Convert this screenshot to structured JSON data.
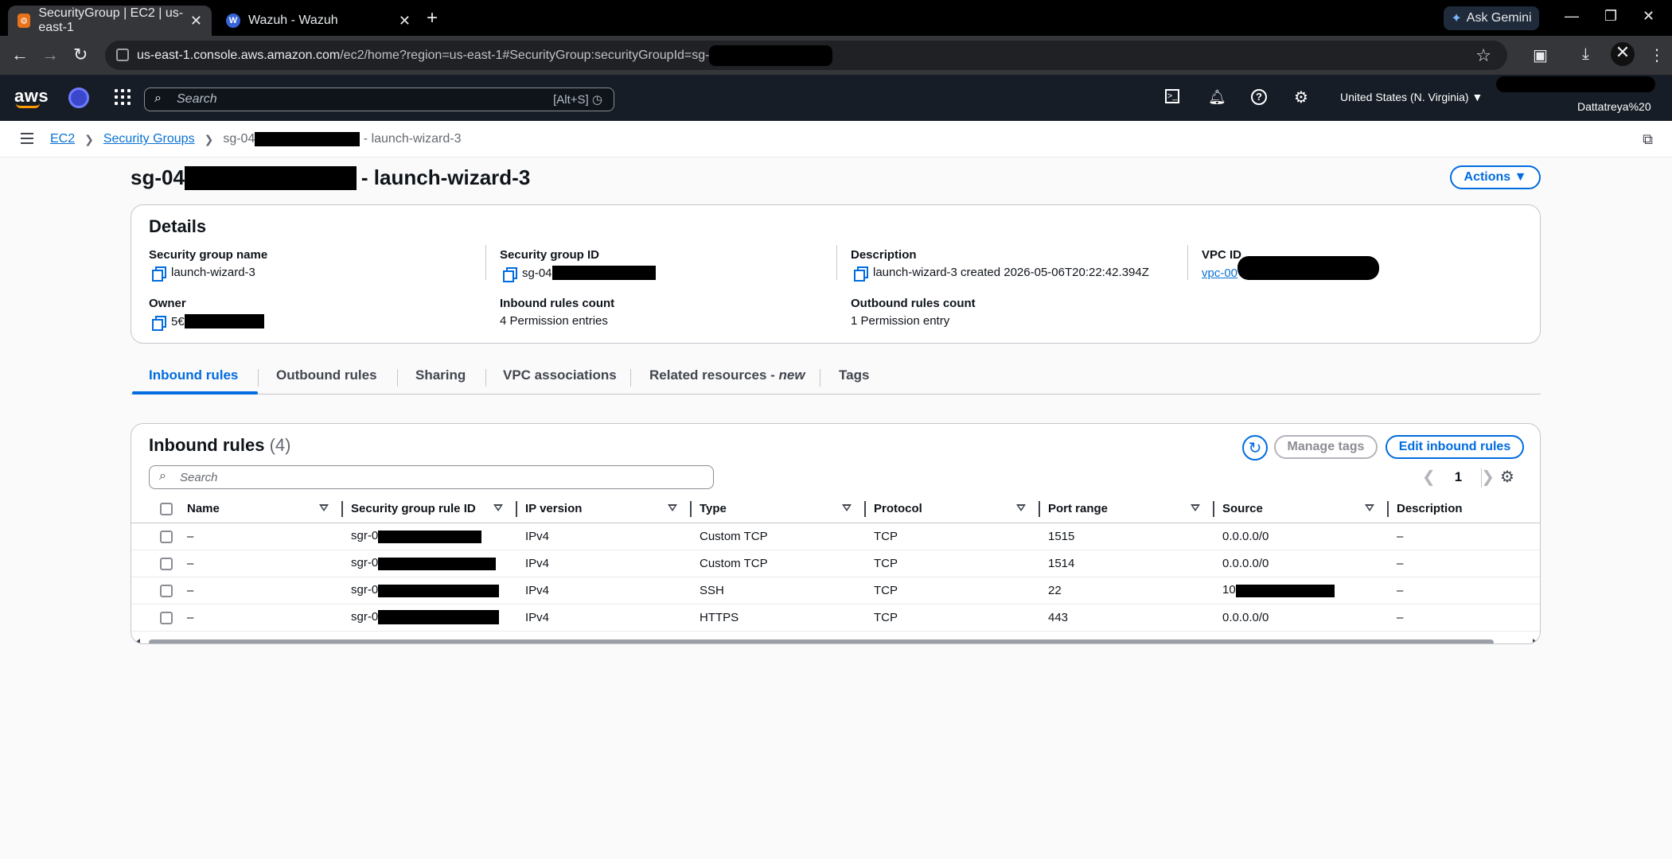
{
  "browser": {
    "tabs": [
      {
        "title": "SecurityGroup | EC2 | us-east-1",
        "active": true
      },
      {
        "title": "Wazuh - Wazuh",
        "active": false
      }
    ],
    "ask_gemini": "Ask Gemini",
    "url_host": "us-east-1.console.aws.amazon.com",
    "url_path": "/ec2/home?region=us-east-1#SecurityGroup:securityGroupId=sg-"
  },
  "aws_nav": {
    "logo": "aws",
    "search_placeholder": "Search",
    "search_shortcut": "[Alt+S]",
    "region": "United States (N. Virginia) ▼",
    "account": "Dattatreya%20"
  },
  "breadcrumb": {
    "items": [
      "EC2",
      "Security Groups"
    ],
    "current_prefix": "sg-04",
    "current_suffix": "- launch-wizard-3"
  },
  "page": {
    "title_prefix": "sg-04",
    "title_suffix": "- launch-wizard-3",
    "actions_label": "Actions ▼"
  },
  "details": {
    "heading": "Details",
    "sg_name_label": "Security group name",
    "sg_name": "launch-wizard-3",
    "sg_id_label": "Security group ID",
    "sg_id_prefix": "sg-04",
    "description_label": "Description",
    "description": "launch-wizard-3 created 2026-05-06T20:22:42.394Z",
    "vpc_label": "VPC ID",
    "vpc_prefix": "vpc-00",
    "owner_label": "Owner",
    "owner_prefix": "5€",
    "inbound_count_label": "Inbound rules count",
    "inbound_count": "4 Permission entries",
    "outbound_count_label": "Outbound rules count",
    "outbound_count": "1 Permission entry"
  },
  "tabs": {
    "inbound": "Inbound rules",
    "outbound": "Outbound rules",
    "sharing": "Sharing",
    "vpc_assoc": "VPC associations",
    "related": "Related resources - ",
    "related_new": "new",
    "tags": "Tags"
  },
  "inbound": {
    "heading": "Inbound rules",
    "count": "(4)",
    "manage_tags": "Manage tags",
    "edit_rules": "Edit inbound rules",
    "search_placeholder": "Search",
    "page": "1",
    "columns": [
      "Name",
      "Security group rule ID",
      "IP version",
      "Type",
      "Protocol",
      "Port range",
      "Source",
      "Description"
    ],
    "rows": [
      {
        "name": "–",
        "rule_id": "sgr-0",
        "ip": "IPv4",
        "type": "Custom TCP",
        "protocol": "TCP",
        "port": "1515",
        "source": "0.0.0.0/0",
        "desc": "–"
      },
      {
        "name": "–",
        "rule_id": "sgr-0",
        "ip": "IPv4",
        "type": "Custom TCP",
        "protocol": "TCP",
        "port": "1514",
        "source": "0.0.0.0/0",
        "desc": "–"
      },
      {
        "name": "–",
        "rule_id": "sgr-0",
        "ip": "IPv4",
        "type": "SSH",
        "protocol": "TCP",
        "port": "22",
        "source": "10",
        "desc": "–"
      },
      {
        "name": "–",
        "rule_id": "sgr-0",
        "ip": "IPv4",
        "type": "HTTPS",
        "protocol": "TCP",
        "port": "443",
        "source": "0.0.0.0/0",
        "desc": "–"
      }
    ]
  }
}
